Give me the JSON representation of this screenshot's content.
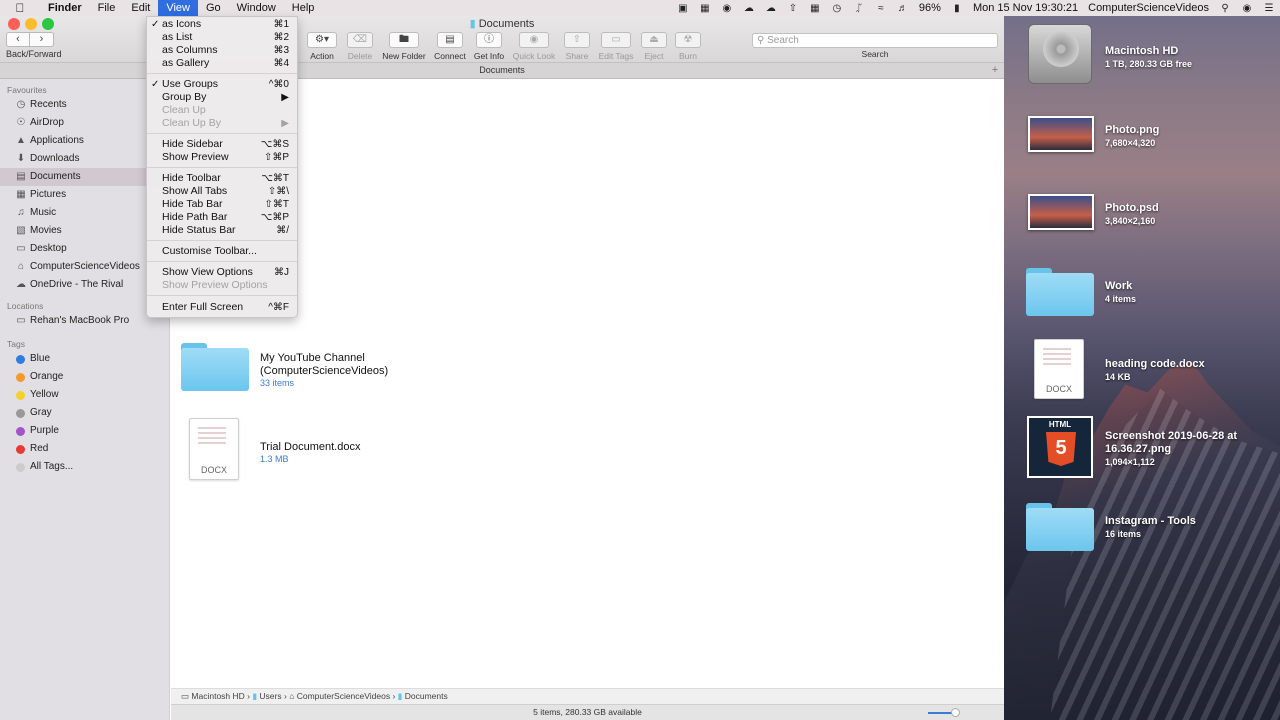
{
  "menubar": {
    "items": [
      "Finder",
      "File",
      "Edit",
      "View",
      "Go",
      "Window",
      "Help"
    ],
    "battery": "96%",
    "datetime": "Mon 15 Nov  19:30:21",
    "user": "ComputerScienceVideos"
  },
  "window": {
    "title": "Documents",
    "nav_label": "Back/Forward",
    "tab_title": "Documents",
    "toolbar": {
      "action": "Action",
      "delete": "Delete",
      "new_folder": "New Folder",
      "connect": "Connect",
      "get_info": "Get Info",
      "quick_look": "Quick Look",
      "share": "Share",
      "edit_tags": "Edit Tags",
      "eject": "Eject",
      "burn": "Burn"
    },
    "search": {
      "placeholder": "Search",
      "label": "Search"
    }
  },
  "sidebar": {
    "favourites_heading": "Favourites",
    "favourites": [
      {
        "label": "Recents",
        "icon": "clock-icon"
      },
      {
        "label": "AirDrop",
        "icon": "airdrop-icon"
      },
      {
        "label": "Applications",
        "icon": "applications-icon"
      },
      {
        "label": "Downloads",
        "icon": "download-icon"
      },
      {
        "label": "Documents",
        "icon": "document-icon"
      },
      {
        "label": "Pictures",
        "icon": "pictures-icon"
      },
      {
        "label": "Music",
        "icon": "music-icon"
      },
      {
        "label": "Movies",
        "icon": "movies-icon"
      },
      {
        "label": "Desktop",
        "icon": "desktop-icon"
      },
      {
        "label": "ComputerScienceVideos",
        "icon": "home-icon"
      },
      {
        "label": "OneDrive - The Rival",
        "icon": "cloud-icon"
      }
    ],
    "locations_heading": "Locations",
    "locations": [
      {
        "label": "Rehan's MacBook Pro",
        "icon": "laptop-icon"
      }
    ],
    "tags_heading": "Tags",
    "tags": [
      {
        "label": "Blue",
        "color": "#2f7de1"
      },
      {
        "label": "Orange",
        "color": "#f39a2b"
      },
      {
        "label": "Yellow",
        "color": "#f5d02a"
      },
      {
        "label": "Gray",
        "color": "#999999"
      },
      {
        "label": "Purple",
        "color": "#a254c8"
      },
      {
        "label": "Red",
        "color": "#e63b35"
      },
      {
        "label": "All Tags...",
        "color": "#cccccc"
      }
    ]
  },
  "files": [
    {
      "name_line1": "My YouTube Channel",
      "name_line2": "(ComputerScienceVideos)",
      "sub": "33 items"
    },
    {
      "name_line1": "Trial Document.docx",
      "sub": "1.3 MB",
      "badge": "DOCX"
    }
  ],
  "pathbar": [
    "Macintosh HD",
    "Users",
    "ComputerScienceVideos",
    "Documents"
  ],
  "status": "5 items, 280.33 GB available",
  "view_menu": {
    "items": [
      {
        "label": "as Icons",
        "shortcut": "⌘1",
        "checked": true
      },
      {
        "label": "as List",
        "shortcut": "⌘2"
      },
      {
        "label": "as Columns",
        "shortcut": "⌘3"
      },
      {
        "label": "as Gallery",
        "shortcut": "⌘4"
      },
      {
        "label": "Use Groups",
        "shortcut": "^⌘0",
        "checked": true
      },
      {
        "label": "Group By",
        "shortcut": "▶"
      },
      {
        "label": "Clean Up",
        "disabled": true
      },
      {
        "label": "Clean Up By",
        "shortcut": "▶",
        "disabled": true
      },
      {
        "label": "Hide Sidebar",
        "shortcut": "⌥⌘S"
      },
      {
        "label": "Show Preview",
        "shortcut": "⇧⌘P"
      },
      {
        "label": "Hide Toolbar",
        "shortcut": "⌥⌘T"
      },
      {
        "label": "Show All Tabs",
        "shortcut": "⇧⌘\\"
      },
      {
        "label": "Hide Tab Bar",
        "shortcut": "⇧⌘T"
      },
      {
        "label": "Hide Path Bar",
        "shortcut": "⌥⌘P"
      },
      {
        "label": "Hide Status Bar",
        "shortcut": "⌘/"
      },
      {
        "label": "Customise Toolbar..."
      },
      {
        "label": "Show View Options",
        "shortcut": "⌘J"
      },
      {
        "label": "Show Preview Options",
        "disabled": true
      },
      {
        "label": "Enter Full Screen",
        "shortcut": "^⌘F"
      }
    ]
  },
  "desktop": [
    {
      "name": "Macintosh HD",
      "sub": "1 TB, 280.33 GB free"
    },
    {
      "name": "Photo.png",
      "sub": "7,680×4,320"
    },
    {
      "name": "Photo.psd",
      "sub": "3,840×2,160"
    },
    {
      "name": "Work",
      "sub": "4 items"
    },
    {
      "name": "heading code.docx",
      "sub": "14 KB",
      "badge": "DOCX"
    },
    {
      "name": "Screenshot 2019-06-28 at",
      "name2": "16.36.27.png",
      "sub": "1,094×1,112",
      "badge": "HTML"
    },
    {
      "name": "Instagram - Tools",
      "sub": "16 items"
    }
  ]
}
